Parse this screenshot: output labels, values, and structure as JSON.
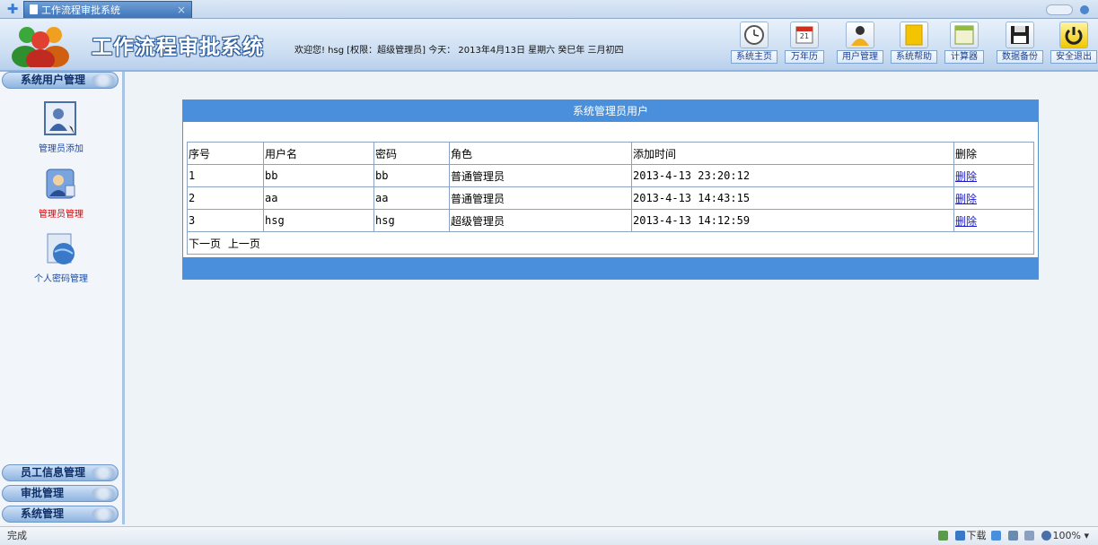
{
  "browser": {
    "tab_title": "工作流程审批系统",
    "tab_close": "×"
  },
  "header": {
    "title": "工作流程审批系统",
    "welcome": "欢迎您! hsg [权限：超级管理员] 今天： 2013年4月13日 星期六 癸巳年 三月初四",
    "calendar_day": "21",
    "toolbar": [
      {
        "label": "系统主页",
        "icon": "clock-icon"
      },
      {
        "label": "万年历",
        "icon": "calendar-icon"
      },
      {
        "label": "用户管理",
        "icon": "user-icon"
      },
      {
        "label": "系统帮助",
        "icon": "help-icon"
      },
      {
        "label": "计算器",
        "icon": "calculator-icon"
      },
      {
        "label": "数据备份",
        "icon": "floppy-disk-icon"
      },
      {
        "label": "安全退出",
        "icon": "power-icon"
      }
    ]
  },
  "sidebar": {
    "top_section": "系统用户管理",
    "items": [
      {
        "label": "管理员添加",
        "icon": "admin-add-icon"
      },
      {
        "label": "管理员管理",
        "icon": "admin-manage-icon"
      },
      {
        "label": "个人密码管理",
        "icon": "password-globe-icon"
      }
    ],
    "bottom_sections": [
      "员工信息管理",
      "审批管理",
      "系统管理"
    ]
  },
  "panel": {
    "title": "系统管理员用户",
    "columns": [
      "序号",
      "用户名",
      "密码",
      "角色",
      "添加时间",
      "删除"
    ],
    "rows": [
      {
        "no": "1",
        "username": "bb",
        "password": "bb",
        "role": "普通管理员",
        "added": "2013-4-13 23:20:12",
        "action": "删除"
      },
      {
        "no": "2",
        "username": "aa",
        "password": "aa",
        "role": "普通管理员",
        "added": "2013-4-13 14:43:15",
        "action": "删除"
      },
      {
        "no": "3",
        "username": "hsg",
        "password": "hsg",
        "role": "超级管理员",
        "added": "2013-4-13 14:12:59",
        "action": "删除"
      }
    ],
    "pager": {
      "next": "下一页",
      "prev": "上一页"
    }
  },
  "status": {
    "left": "完成",
    "download": "下载",
    "zoom": "100%"
  }
}
